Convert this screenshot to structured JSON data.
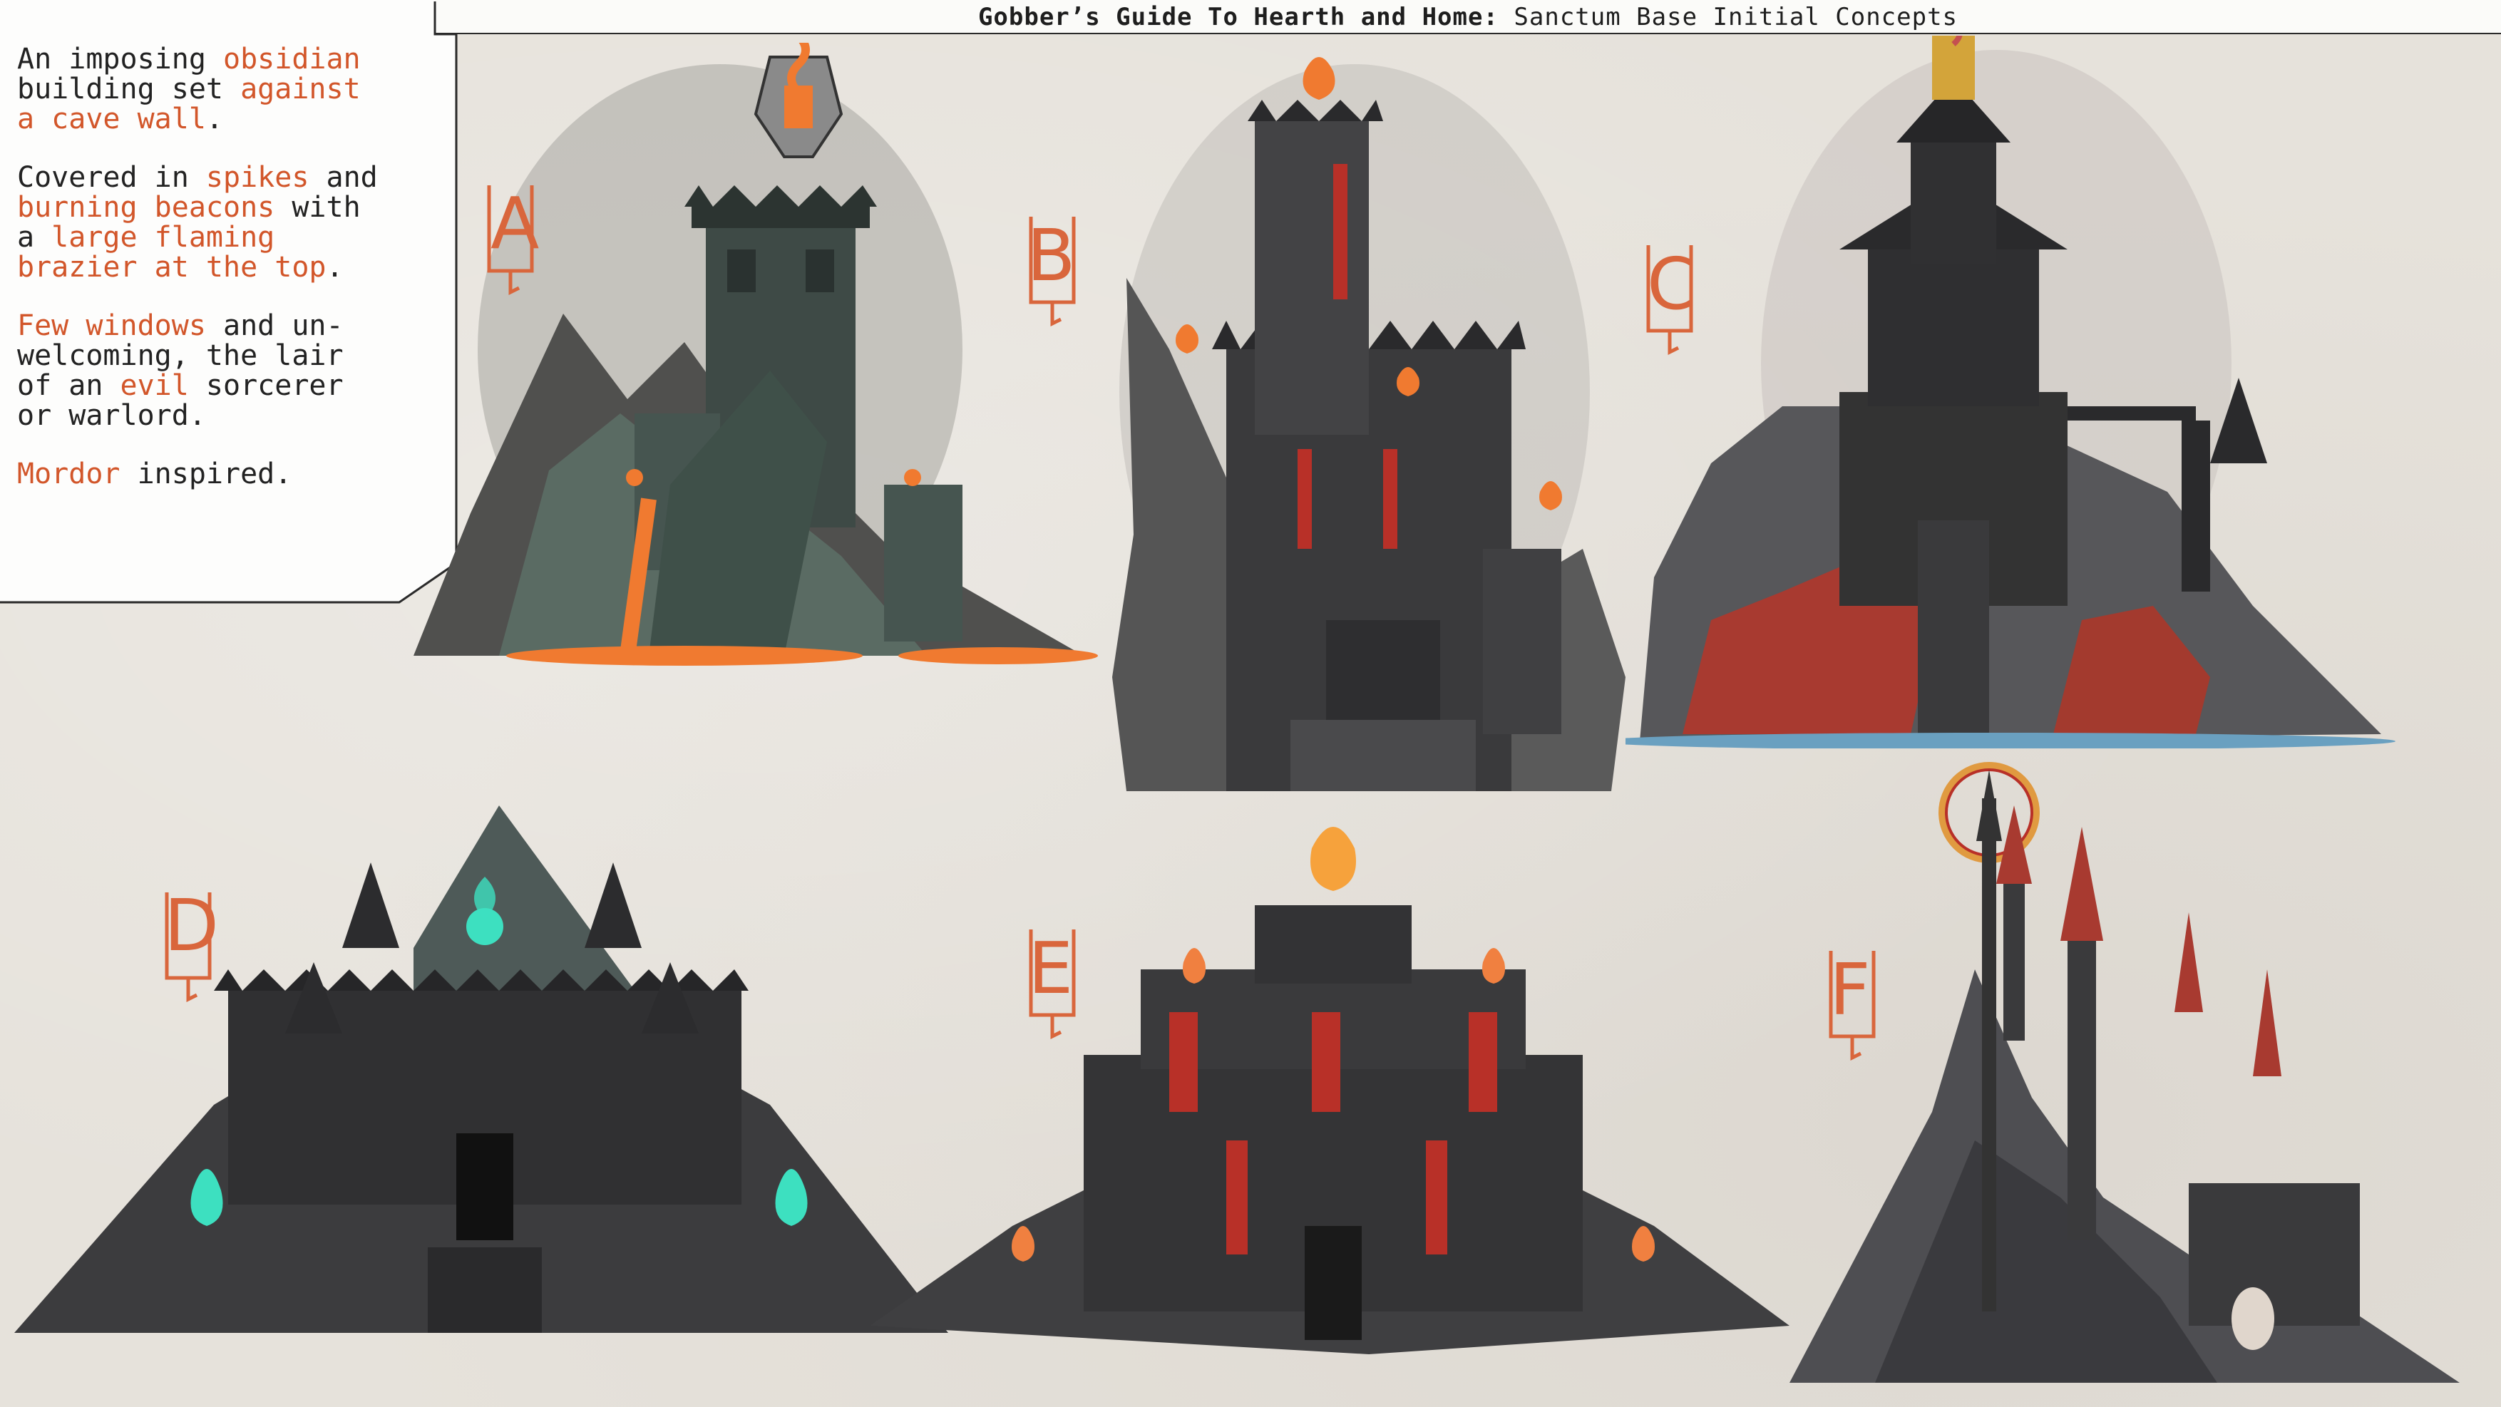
{
  "title": {
    "bold": "Gobber’s Guide To Hearth and Home:",
    "rest": " Sanctum Base Initial Concepts"
  },
  "caption": {
    "paragraphs": [
      [
        {
          "t": "An imposing ",
          "hl": false
        },
        {
          "t": "obsidian",
          "hl": true
        },
        {
          "t": "\nbuilding set ",
          "hl": false
        },
        {
          "t": "against\na cave wall",
          "hl": true
        },
        {
          "t": ".",
          "hl": false
        }
      ],
      [
        {
          "t": "Covered in ",
          "hl": false
        },
        {
          "t": "spikes",
          "hl": true
        },
        {
          "t": " and\n",
          "hl": false
        },
        {
          "t": "burning beacons",
          "hl": true
        },
        {
          "t": " with\na ",
          "hl": false
        },
        {
          "t": "large flaming\nbrazier at the top",
          "hl": true
        },
        {
          "t": ".",
          "hl": false
        }
      ],
      [
        {
          "t": "Few windows",
          "hl": true
        },
        {
          "t": " and un-\nwelcoming, the lair\nof an ",
          "hl": false
        },
        {
          "t": "evil",
          "hl": true
        },
        {
          "t": " sorcerer\nor warlord.",
          "hl": false
        }
      ],
      [
        {
          "t": "Mordor",
          "hl": true
        },
        {
          "t": " inspired.",
          "hl": false
        }
      ]
    ]
  },
  "concepts": [
    {
      "letter": "A"
    },
    {
      "letter": "B"
    },
    {
      "letter": "C"
    },
    {
      "letter": "D"
    },
    {
      "letter": "E"
    },
    {
      "letter": "F"
    }
  ],
  "colors": {
    "accent": "#d2562a",
    "lava": "#f07a30",
    "obsidian": "#3a3a3c",
    "teal_stone": "#4a5a55",
    "banner_red": "#b83028",
    "green_flame": "#3de0c0",
    "blood_rock": "#a83a30"
  }
}
